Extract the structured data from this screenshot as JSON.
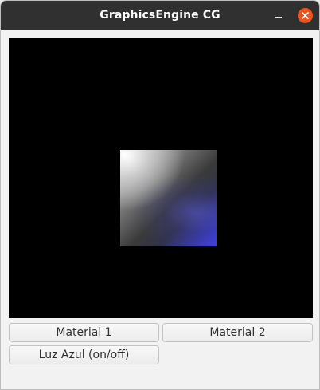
{
  "window": {
    "title": "GraphicsEngine CG"
  },
  "title_controls": {
    "minimize_icon": "minimize-icon",
    "close_icon": "close-icon",
    "close_color": "#e95420"
  },
  "viewport": {
    "background": "#000000",
    "object": "shaded-quad"
  },
  "buttons": {
    "material1": "Material 1",
    "material2": "Material 2",
    "luz_azul": "Luz Azul (on/off)"
  }
}
